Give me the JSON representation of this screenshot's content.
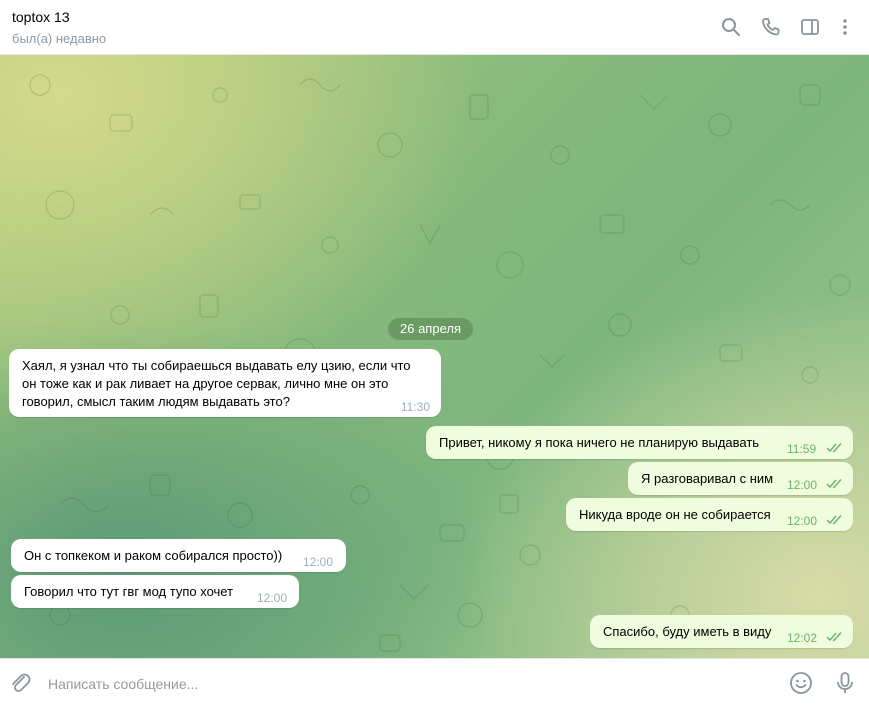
{
  "header": {
    "title": "toptox 13",
    "status": "был(а) недавно",
    "icons": [
      "search-icon",
      "phone-icon",
      "sidebar-icon",
      "more-vertical-icon"
    ]
  },
  "chat": {
    "date_separator": "26 апреля",
    "messages": [
      {
        "direction": "incoming",
        "lines": [
          "Хаял, я узнал что ты собираешься выдавать елу цзию, если что",
          "он тоже как и рак ливает на другое сервак, лично мне он это",
          "говорил, смысл таким людям выдавать это?"
        ],
        "time": "11:30"
      },
      {
        "direction": "outgoing",
        "text": "Привет, никому я пока ничего не планирую выдавать",
        "time": "11:59",
        "status": "read"
      },
      {
        "direction": "outgoing",
        "text": "Я разговаривал с ним",
        "time": "12:00",
        "status": "read"
      },
      {
        "direction": "outgoing",
        "text": "Никуда вроде он не собирается",
        "time": "12:00",
        "status": "read"
      },
      {
        "direction": "incoming",
        "text": "Он с топкеком и раком собирался просто))",
        "time": "12:00"
      },
      {
        "direction": "incoming",
        "text": "Говорил что тут гвг мод тупо хочет",
        "time": "12:00"
      },
      {
        "direction": "outgoing",
        "text": "Спасибо, буду иметь в виду",
        "time": "12:02",
        "status": "read"
      }
    ]
  },
  "composer": {
    "placeholder": "Написать сообщение...",
    "icons": [
      "attach-icon",
      "emoji-icon",
      "microphone-icon"
    ]
  },
  "colors": {
    "outgoing_bubble": "#effdde",
    "incoming_bubble": "#ffffff",
    "read_ticks": "#6cb36a"
  }
}
